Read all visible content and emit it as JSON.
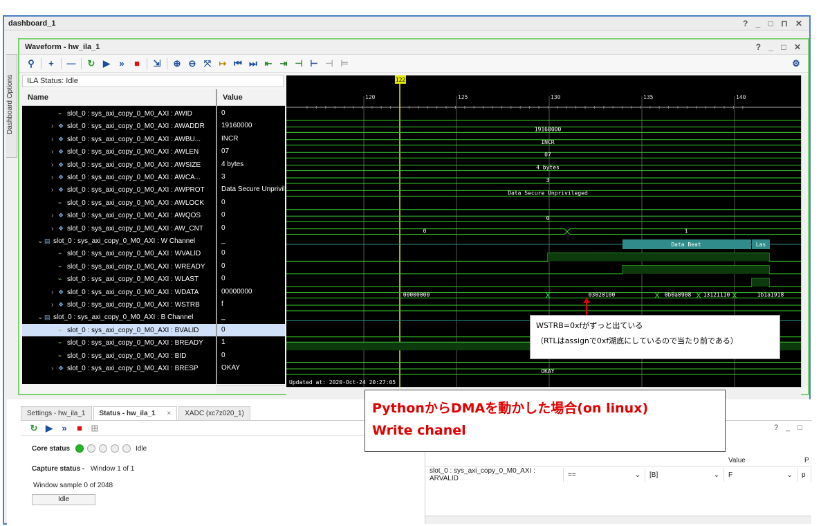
{
  "window": {
    "title": "dashboard_1",
    "controls": "? _ □ ⊓ ✕"
  },
  "side_tab": {
    "label": "Dashboard Options"
  },
  "waveform": {
    "title": "Waveform - hw_ila_1",
    "controls": "? _ □ ✕",
    "ila_status": "ILA Status: Idle",
    "col_name": "Name",
    "col_value": "Value",
    "cursor_label": "122",
    "time_ticks": [
      "120",
      "125",
      "130",
      "135",
      "140"
    ],
    "updated": "Updated at: 2020-Oct-24 20:27:05",
    "rows": [
      {
        "name": "slot_0 : sys_axi_copy_0_M0_AXI : AWID",
        "value": "0",
        "kind": "sig",
        "indent": 2,
        "arrow": ""
      },
      {
        "name": "slot_0 : sys_axi_copy_0_M0_AXI : AWADDR",
        "value": "19160000",
        "kind": "bus",
        "indent": 2,
        "arrow": ">"
      },
      {
        "name": "slot_0 : sys_axi_copy_0_M0_AXI : AWBU...",
        "value": "INCR",
        "kind": "bus",
        "indent": 2,
        "arrow": ">"
      },
      {
        "name": "slot_0 : sys_axi_copy_0_M0_AXI : AWLEN",
        "value": "07",
        "kind": "bus",
        "indent": 2,
        "arrow": ">"
      },
      {
        "name": "slot_0 : sys_axi_copy_0_M0_AXI : AWSIZE",
        "value": "4 bytes",
        "kind": "bus",
        "indent": 2,
        "arrow": ">"
      },
      {
        "name": "slot_0 : sys_axi_copy_0_M0_AXI : AWCA...",
        "value": "3",
        "kind": "bus",
        "indent": 2,
        "arrow": ">"
      },
      {
        "name": "slot_0 : sys_axi_copy_0_M0_AXI : AWPROT",
        "value": "Data Secure Unprivileg",
        "kind": "bus",
        "indent": 2,
        "arrow": ">"
      },
      {
        "name": "slot_0 : sys_axi_copy_0_M0_AXI : AWLOCK",
        "value": "0",
        "kind": "sig",
        "indent": 2,
        "arrow": ""
      },
      {
        "name": "slot_0 : sys_axi_copy_0_M0_AXI : AWQOS",
        "value": "0",
        "kind": "bus",
        "indent": 2,
        "arrow": ">"
      },
      {
        "name": "slot_0 : sys_axi_copy_0_M0_AXI : AW_CNT",
        "value": "0",
        "kind": "bus",
        "indent": 2,
        "arrow": ">"
      },
      {
        "name": "slot_0 : sys_axi_copy_0_M0_AXI : W Channel",
        "value": "_",
        "kind": "group",
        "indent": 1,
        "arrow": "v"
      },
      {
        "name": "slot_0 : sys_axi_copy_0_M0_AXI : WVALID",
        "value": "0",
        "kind": "sig",
        "indent": 2,
        "arrow": ""
      },
      {
        "name": "slot_0 : sys_axi_copy_0_M0_AXI : WREADY",
        "value": "0",
        "kind": "sig",
        "indent": 2,
        "arrow": ""
      },
      {
        "name": "slot_0 : sys_axi_copy_0_M0_AXI : WLAST",
        "value": "0",
        "kind": "sig",
        "indent": 2,
        "arrow": ""
      },
      {
        "name": "slot_0 : sys_axi_copy_0_M0_AXI : WDATA",
        "value": "00000000",
        "kind": "bus",
        "indent": 2,
        "arrow": ">"
      },
      {
        "name": "slot_0 : sys_axi_copy_0_M0_AXI : WSTRB",
        "value": "f",
        "kind": "bus",
        "indent": 2,
        "arrow": ">"
      },
      {
        "name": "slot_0 : sys_axi_copy_0_M0_AXI : B Channel",
        "value": "_",
        "kind": "group",
        "indent": 1,
        "arrow": "v"
      },
      {
        "name": "slot_0 : sys_axi_copy_0_M0_AXI : BVALID",
        "value": "0",
        "kind": "sig",
        "indent": 2,
        "arrow": "",
        "selected": true
      },
      {
        "name": "slot_0 : sys_axi_copy_0_M0_AXI : BREADY",
        "value": "1",
        "kind": "sig",
        "indent": 2,
        "arrow": ""
      },
      {
        "name": "slot_0 : sys_axi_copy_0_M0_AXI : BID",
        "value": "0",
        "kind": "sig",
        "indent": 2,
        "arrow": ""
      },
      {
        "name": "slot_0 : sys_axi_copy_0_M0_AXI : BRESP",
        "value": "OKAY",
        "kind": "bus",
        "indent": 2,
        "arrow": ">"
      }
    ],
    "wave_labels": {
      "awaddr": "19160000",
      "awburst": "INCR",
      "awlen": "07",
      "awsize": "4 bytes",
      "awcache": "3",
      "awprot": "Data Secure Unprivileged",
      "awqos": "0",
      "awcnt_a": "0",
      "awcnt_b": "1",
      "wch": "Data Beat",
      "wch_last": "Las",
      "wdata_0": "00000000",
      "wdata_1": "03020100",
      "wdata_2": "0b0a0908",
      "wdata_3": "13121110",
      "wdata_4": "1b1a1918",
      "bresp": "OKAY"
    }
  },
  "bottom": {
    "tabs": [
      "Settings - hw_ila_1",
      "Status - hw_ila_1",
      "XADC (xc7z020_1)"
    ],
    "close_glyph": "×",
    "core_status_label": "Core status",
    "core_status_value": "Idle",
    "capture_status_label": "Capture status -",
    "capture_status_value": "Window 1 of 1",
    "window_sample": "Window sample 0 of 2048",
    "state_button": "Idle",
    "trigger": {
      "controls": "? _ □",
      "value_header": "Value",
      "pe_header": "P",
      "name": "slot_0 : sys_axi_copy_0_M0_AXI : ARVALID",
      "operator": "==",
      "radix": "[B]",
      "value": "F",
      "pe": "p"
    }
  },
  "notes": {
    "small_line1": "WSTRB=0xfがずっと出ている",
    "small_line2": "（RTLはassignで0xf湖底にしているので当たり前である）",
    "big_line1": "PythonからDMAを動かした場合(on linux)",
    "big_line2": "Write chanel"
  },
  "colors": {
    "wave_green": "#39d42c",
    "bus_fill": "#0d3a0d",
    "teal": "#2f8c8a",
    "cursor": "#e8e800",
    "note_red": "#e00000"
  }
}
